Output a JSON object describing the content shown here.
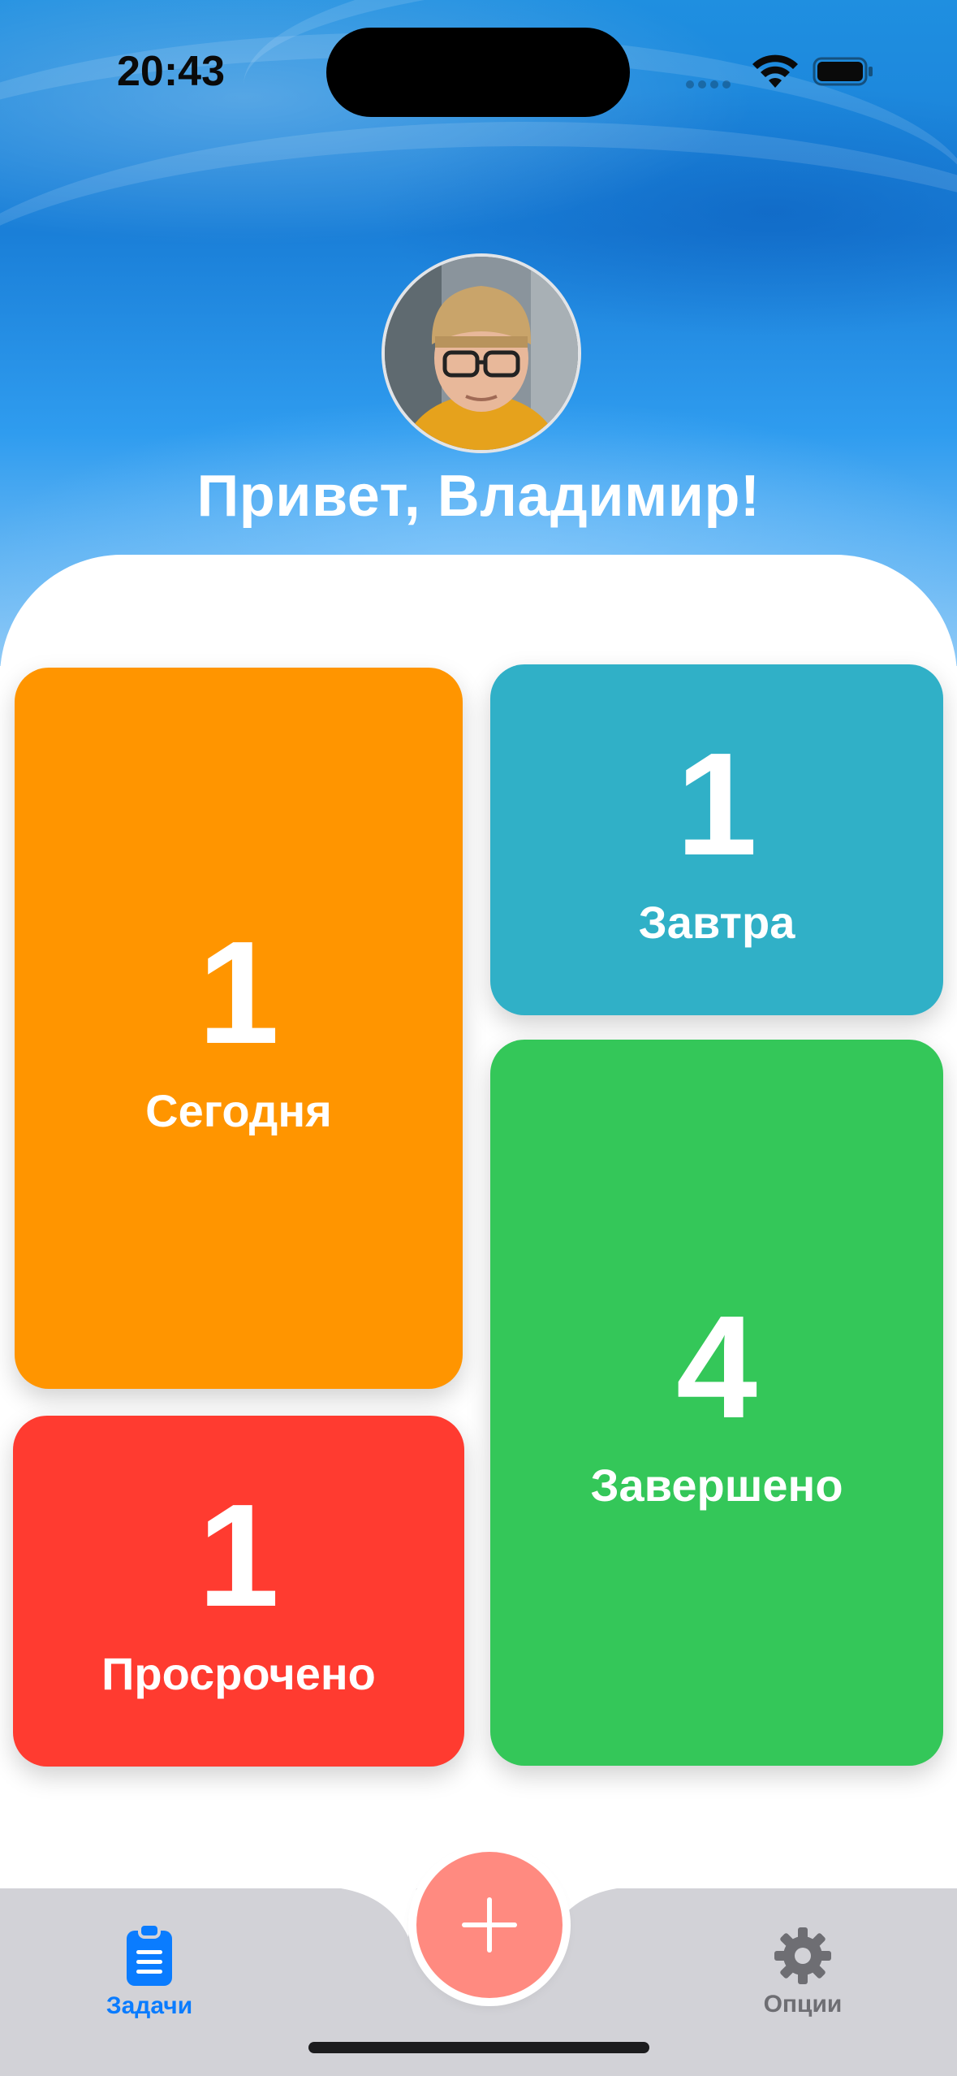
{
  "status_bar": {
    "time": "20:43"
  },
  "header": {
    "greeting": "Привет, Владимир!"
  },
  "tiles": {
    "today": {
      "count": "1",
      "label": "Сегодня",
      "color": "#ff9500"
    },
    "tomorrow": {
      "count": "1",
      "label": "Завтра",
      "color": "#30b0c7"
    },
    "completed": {
      "count": "4",
      "label": "Завершено",
      "color": "#34c759"
    },
    "overdue": {
      "count": "1",
      "label": "Просрочено",
      "color": "#ff3b30"
    }
  },
  "tab_bar": {
    "tasks_label": "Задачи",
    "options_label": "Опции",
    "active_color": "#0a7cff",
    "inactive_color": "#6e6e73",
    "add_button_color": "#ff8a80"
  },
  "icons": {
    "tasks": "clipboard-icon",
    "options": "gear-icon",
    "add": "plus-icon"
  }
}
